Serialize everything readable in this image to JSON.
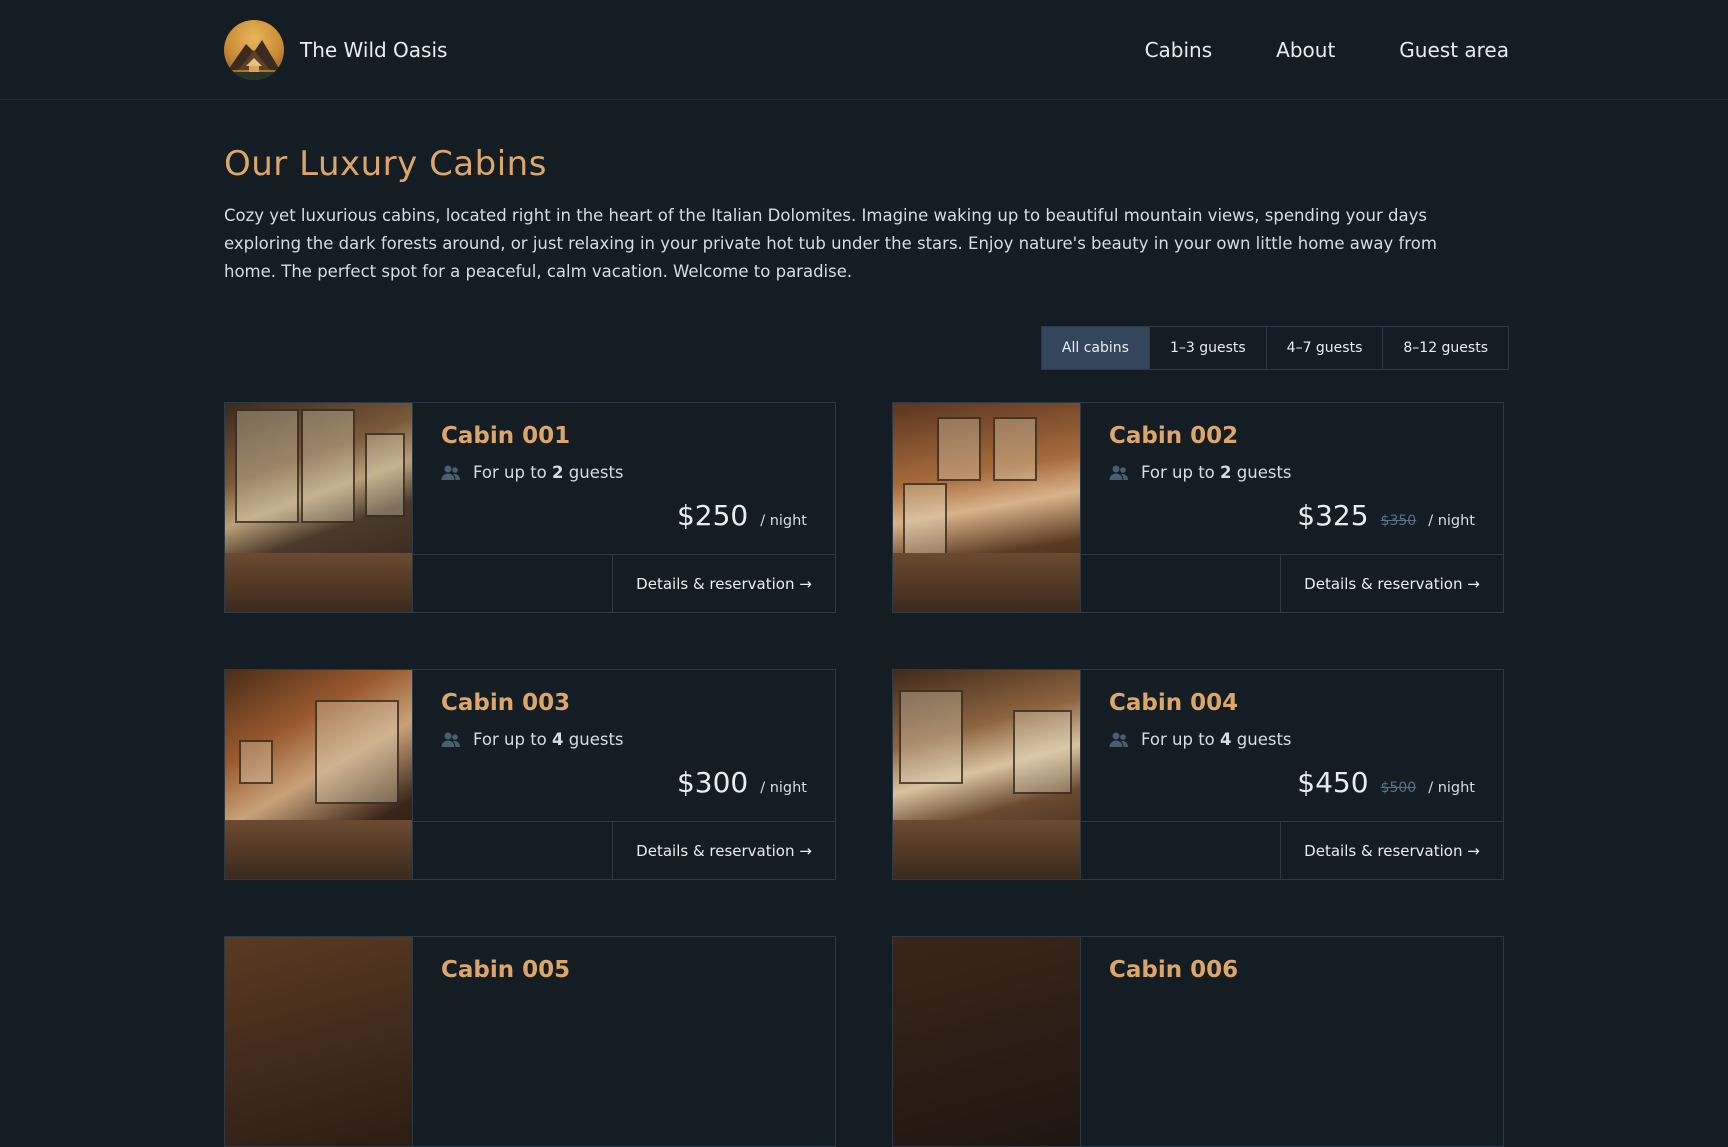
{
  "header": {
    "brand_name": "The Wild Oasis",
    "nav": [
      {
        "label": "Cabins"
      },
      {
        "label": "About"
      },
      {
        "label": "Guest area"
      }
    ]
  },
  "main": {
    "title": "Our Luxury Cabins",
    "intro": "Cozy yet luxurious cabins, located right in the heart of the Italian Dolomites. Imagine waking up to beautiful mountain views, spending your days exploring the dark forests around, or just relaxing in your private hot tub under the stars. Enjoy nature's beauty in your own little home away from home. The perfect spot for a peaceful, calm vacation. Welcome to paradise.",
    "filters": [
      {
        "label": "All cabins",
        "active": true
      },
      {
        "label": "1–3 guests",
        "active": false
      },
      {
        "label": "4–7 guests",
        "active": false
      },
      {
        "label": "8–12 guests",
        "active": false
      }
    ],
    "cabins": [
      {
        "name": "Cabin 001",
        "capacity_prefix": "For up to",
        "capacity": "2",
        "capacity_suffix": "guests",
        "price": "$250",
        "old_price": "",
        "per_night": "/ night",
        "cta": "Details & reservation →"
      },
      {
        "name": "Cabin 002",
        "capacity_prefix": "For up to",
        "capacity": "2",
        "capacity_suffix": "guests",
        "price": "$325",
        "old_price": "$350",
        "per_night": "/ night",
        "cta": "Details & reservation →"
      },
      {
        "name": "Cabin 003",
        "capacity_prefix": "For up to",
        "capacity": "4",
        "capacity_suffix": "guests",
        "price": "$300",
        "old_price": "",
        "per_night": "/ night",
        "cta": "Details & reservation →"
      },
      {
        "name": "Cabin 004",
        "capacity_prefix": "For up to",
        "capacity": "4",
        "capacity_suffix": "guests",
        "price": "$450",
        "old_price": "$500",
        "per_night": "/ night",
        "cta": "Details & reservation →"
      },
      {
        "name": "Cabin 005"
      },
      {
        "name": "Cabin 006"
      }
    ]
  },
  "colors": {
    "background": "#141c24",
    "accent": "#dca66a",
    "border": "#2c3947",
    "active_filter": "#34475a"
  },
  "icons": {
    "capacity": "users-icon",
    "logo": "mountain-cabin-logo"
  }
}
